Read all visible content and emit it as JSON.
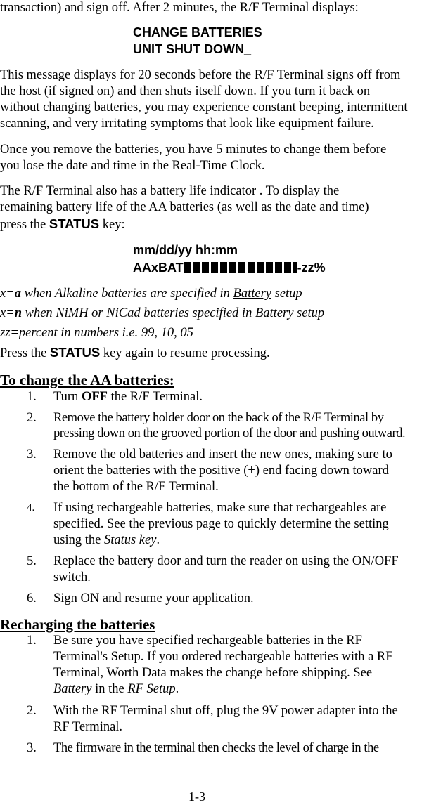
{
  "intro": {
    "line1": "transaction) and sign off.  After 2 minutes, the R/F Terminal  displays:"
  },
  "display1": {
    "line1": "CHANGE BATTERIES",
    "line2": "UNIT SHUT DOWN_"
  },
  "para1": [
    "This message displays for 20 seconds before the R/F Terminal signs off from",
    "the host (if signed on) and then shuts itself down. If you turn it back on",
    "without changing batteries, you may experience constant beeping, intermittent",
    "scanning, and very irritating symptoms that look like equipment failure."
  ],
  "para2": [
    "Once you remove the batteries, you have 5 minutes to change them before",
    "you lose the date and time in the Real-Time Clock."
  ],
  "para3": {
    "lines": [
      "The R/F Terminal also has a battery life indicator .  To display the",
      "remaining battery life of the AA batteries (as well as the date and time)"
    ],
    "line3_pre": "press the ",
    "line3_key": "STATUS",
    "line3_post": " key:"
  },
  "display2": {
    "line1": "mm/dd/yy  hh:mm",
    "line2_prefix": "AAxBAT",
    "line2_suffix": "-zz%",
    "bar_blocks": 12,
    "bar_partial": true
  },
  "legend": {
    "x_a": {
      "var": "x=",
      "val": "a",
      "text": " when Alkaline batteries are specified in ",
      "link": "Battery",
      "end": " setup"
    },
    "x_n": {
      "var": "x=",
      "val": "n",
      "text": " when NiMH or NiCad batteries specified in ",
      "link": "Battery",
      "end": " setup"
    },
    "zz": "zz=percent in numbers i.e. 99, 10, 05"
  },
  "resume": {
    "pre": "Press the ",
    "key": "STATUS",
    "post": " key again to resume processing."
  },
  "section1": {
    "title": "To change the AA batteries:",
    "items": [
      {
        "num": "1.",
        "pre": "Turn ",
        "bold": "OFF",
        "post": " the R/F Terminal."
      },
      {
        "num": "2.",
        "lines": [
          "Remove the battery holder door on the back of the R/F Terminal by",
          "pressing down on the grooved portion of the door and pushing outward."
        ]
      },
      {
        "num": "3.",
        "lines": [
          "Remove the old batteries and insert the new ones, making sure to",
          "orient the batteries with the positive (+) end facing down toward",
          "the bottom of the R/F Terminal."
        ]
      },
      {
        "num": "4.",
        "lines": [
          "If using rechargeable batteries, make sure that rechargeables are",
          "specified. See the previous page to quickly determine the setting"
        ],
        "line3_pre": "using the ",
        "line3_ital": "Status key",
        "line3_post": "."
      },
      {
        "num": "5.",
        "lines": [
          "Replace the battery door and turn the reader on using the ON/OFF",
          "switch."
        ]
      },
      {
        "num": "6.",
        "lines": [
          "Sign ON and resume your application."
        ]
      }
    ]
  },
  "section2": {
    "title": "Recharging the batteries",
    "items": [
      {
        "num": "1.",
        "lines": [
          "Be sure you have specified rechargeable batteries in the RF",
          "Terminal's Setup. If you ordered rechargeable batteries with a RF",
          "Terminal, Worth Data makes the change before shipping. See"
        ],
        "l4_ital1": "Battery",
        "l4_mid": " in the ",
        "l4_ital2": "RF Setup",
        "l4_end": "."
      },
      {
        "num": "2.",
        "lines": [
          "With the RF Terminal shut off, plug the 9V power adapter into the",
          "RF Terminal."
        ]
      },
      {
        "num": "3.",
        "lines": [
          "The firmware in the terminal then checks the level of charge in the"
        ]
      }
    ]
  },
  "footer": {
    "page_number": "1-3"
  }
}
